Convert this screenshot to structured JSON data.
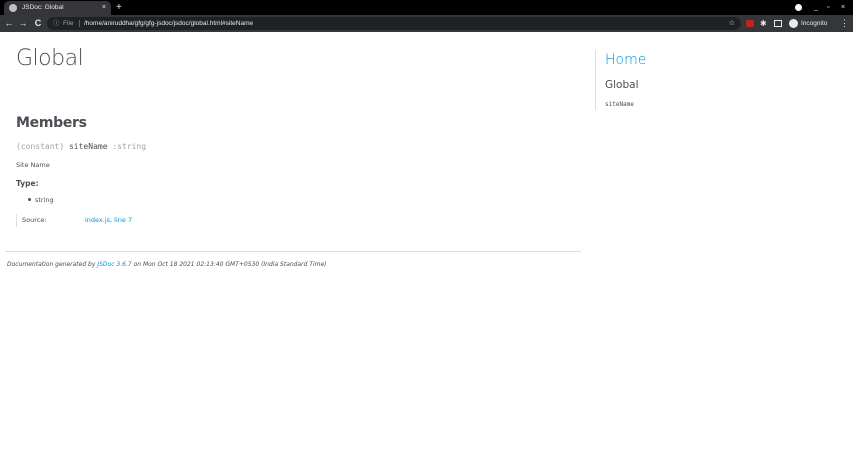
{
  "browser": {
    "tab_title": "JSDoc: Global",
    "tab_close": "×",
    "new_tab": "+",
    "file_label": "File",
    "url": "/home/aniruddha/gfg/gfg-jsdoc/jsdoc/global.html#siteName",
    "incognito_label": "Incognito",
    "back_icon": "←",
    "forward_icon": "→",
    "reload_icon": "C",
    "star_icon": "☆",
    "menu_icon": "⋮",
    "minimize": "_",
    "restore": "▫",
    "close": "×"
  },
  "page": {
    "title": "Global",
    "members_heading": "Members",
    "member": {
      "attribs": "(constant) ",
      "name": "siteName",
      "type_sig": " :string",
      "description": "Site Name",
      "type_heading": "Type:",
      "type_value": "string",
      "source_label": "Source:",
      "source_link": "index.js, line 7"
    },
    "footer": {
      "prefix": "Documentation generated by ",
      "link": "JSDoc 3.6.7",
      "suffix": " on Mon Oct 18 2021 02:13:40 GMT+0530 (India Standard Time)"
    }
  },
  "nav": {
    "home": "Home",
    "global": "Global",
    "member": "siteName"
  },
  "colors": {
    "link": "#0095dd",
    "text": "#4d4e53"
  }
}
